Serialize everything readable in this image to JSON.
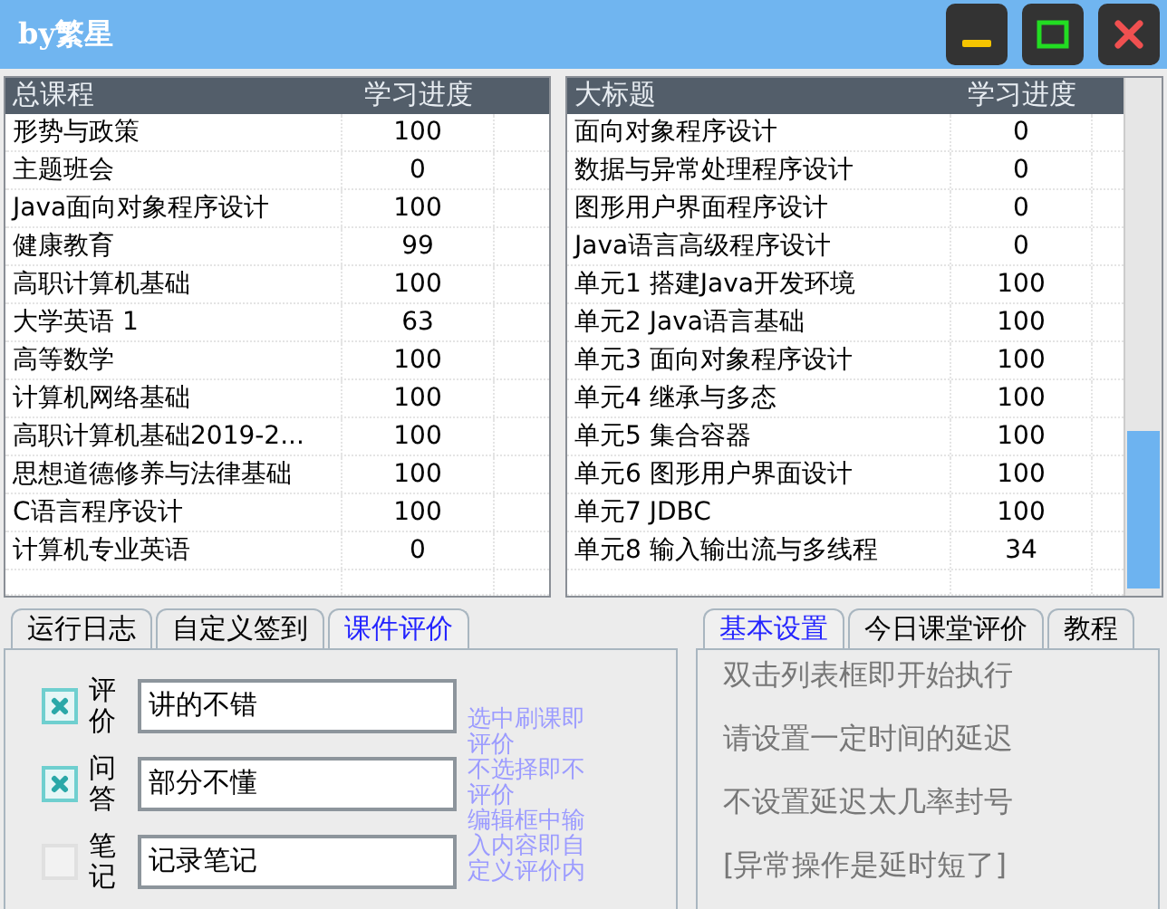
{
  "window": {
    "title": "by繁星"
  },
  "course_table": {
    "columns": [
      "总课程",
      "学习进度"
    ],
    "rows": [
      {
        "name": "形势与政策",
        "progress": "100"
      },
      {
        "name": "主题班会",
        "progress": "0"
      },
      {
        "name": "Java面向对象程序设计",
        "progress": "100"
      },
      {
        "name": "健康教育",
        "progress": "99"
      },
      {
        "name": "高职计算机基础",
        "progress": "100"
      },
      {
        "name": "大学英语 1",
        "progress": "63"
      },
      {
        "name": "高等数学",
        "progress": "100"
      },
      {
        "name": "计算机网络基础",
        "progress": "100"
      },
      {
        "name": "高职计算机基础2019-2...",
        "progress": "100"
      },
      {
        "name": "思想道德修养与法律基础",
        "progress": "100"
      },
      {
        "name": "C语言程序设计",
        "progress": "100"
      },
      {
        "name": "计算机专业英语",
        "progress": "0"
      }
    ]
  },
  "chapter_table": {
    "columns": [
      "大标题",
      "学习进度"
    ],
    "rows": [
      {
        "name": "面向对象程序设计",
        "progress": "0"
      },
      {
        "name": "数据与异常处理程序设计",
        "progress": "0"
      },
      {
        "name": "图形用户界面程序设计",
        "progress": "0"
      },
      {
        "name": "Java语言高级程序设计",
        "progress": "0"
      },
      {
        "name": "单元1 搭建Java开发环境",
        "progress": "100"
      },
      {
        "name": "单元2 Java语言基础",
        "progress": "100"
      },
      {
        "name": "单元3 面向对象程序设计",
        "progress": "100"
      },
      {
        "name": "单元4 继承与多态",
        "progress": "100"
      },
      {
        "name": "单元5 集合容器",
        "progress": "100"
      },
      {
        "name": "单元6 图形用户界面设计",
        "progress": "100"
      },
      {
        "name": "单元7 JDBC",
        "progress": "100"
      },
      {
        "name": "单元8 输入输出流与多线程",
        "progress": "34"
      }
    ]
  },
  "left_tabs": [
    {
      "label": "运行日志",
      "selected": false
    },
    {
      "label": "自定义签到",
      "selected": false
    },
    {
      "label": "课件评价",
      "selected": true
    }
  ],
  "evaluation_options": [
    {
      "label": "评价",
      "checked": true,
      "value": "讲的不错"
    },
    {
      "label": "问答",
      "checked": true,
      "value": "部分不懂"
    },
    {
      "label": "笔记",
      "checked": false,
      "value": "记录笔记"
    }
  ],
  "evaluation_hints": [
    "选中刷课即评价",
    "不选择即不评价",
    "编辑框中输入内容即自定义评价内"
  ],
  "right_tabs": [
    {
      "label": "基本设置",
      "selected": true
    },
    {
      "label": "今日课堂评价",
      "selected": false
    },
    {
      "label": "教程",
      "selected": false
    }
  ],
  "settings_notes": [
    "双击列表框即开始执行",
    "请设置一定时间的延迟",
    "不设置延迟太几率封号",
    "[异常操作是延时短了]"
  ]
}
